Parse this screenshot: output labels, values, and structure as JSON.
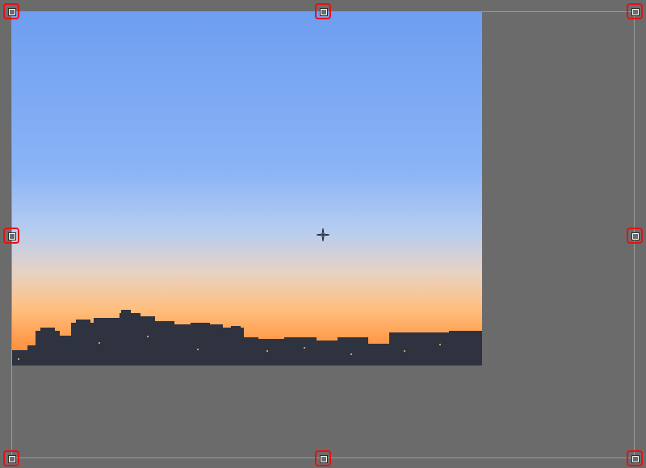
{
  "colors": {
    "canvas": "#6b6b6b",
    "frame_border": "#9a9a9a",
    "handle_highlight": "#e81010",
    "sky_top": "#6e9ef0",
    "sky_mid": "#a7c4f2",
    "horizon_glow": "#ffb16a",
    "horizon_low": "#ff8a3c",
    "buildings": "#2f3340"
  },
  "icons": {
    "handles": "square-transform-handle-icon",
    "pivot": "crosshair-pivot-icon"
  },
  "handles": [
    {
      "name": "handle-top-left",
      "highlighted": true
    },
    {
      "name": "handle-top-center",
      "highlighted": true
    },
    {
      "name": "handle-top-right",
      "highlighted": true
    },
    {
      "name": "handle-middle-left",
      "highlighted": true
    },
    {
      "name": "handle-middle-right",
      "highlighted": true
    },
    {
      "name": "handle-bottom-left",
      "highlighted": true
    },
    {
      "name": "handle-bottom-center",
      "highlighted": true
    },
    {
      "name": "handle-bottom-right",
      "highlighted": true
    }
  ]
}
